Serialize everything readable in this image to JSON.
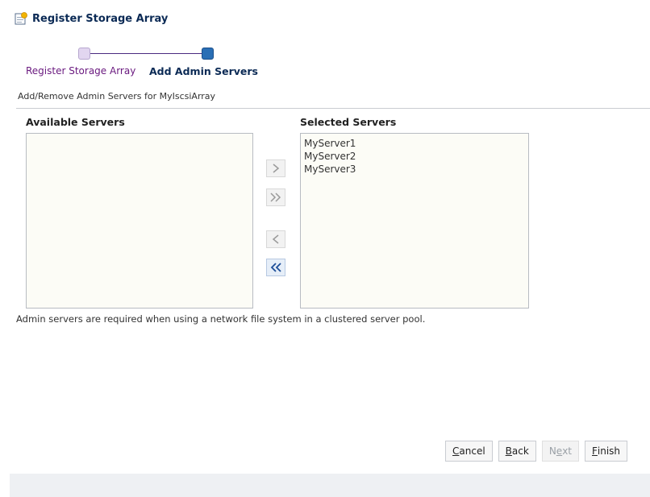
{
  "dialog": {
    "title": "Register Storage Array"
  },
  "train": {
    "steps": [
      {
        "label": "Register Storage Array",
        "state": "visited"
      },
      {
        "label": "Add Admin Servers",
        "state": "current"
      }
    ]
  },
  "section": {
    "subheader": "Add/Remove Admin Servers for MyIscsiArray"
  },
  "shuttle": {
    "available_title": "Available Servers",
    "selected_title": "Selected Servers",
    "available_items": [],
    "selected_items": [
      "MyServer1",
      "MyServer2",
      "MyServer3"
    ],
    "move_right_icon": "chevron-right-icon",
    "move_all_right_icon": "double-chevron-right-icon",
    "move_left_icon": "chevron-left-icon",
    "move_all_left_icon": "double-chevron-left-icon"
  },
  "note": "Admin servers are required when using a network file system in a clustered server pool.",
  "footer": {
    "cancel": {
      "pre": "",
      "key": "C",
      "post": "ancel"
    },
    "back": {
      "pre": "",
      "key": "B",
      "post": "ack"
    },
    "next": {
      "pre": "N",
      "key": "e",
      "post": "xt"
    },
    "finish": {
      "pre": "",
      "key": "F",
      "post": "inish"
    }
  },
  "colors": {
    "title": "#0b2a55",
    "visited_step": "#6b1b80",
    "current_step_marker": "#2a6fb5",
    "list_background": "#fcfcf6"
  }
}
